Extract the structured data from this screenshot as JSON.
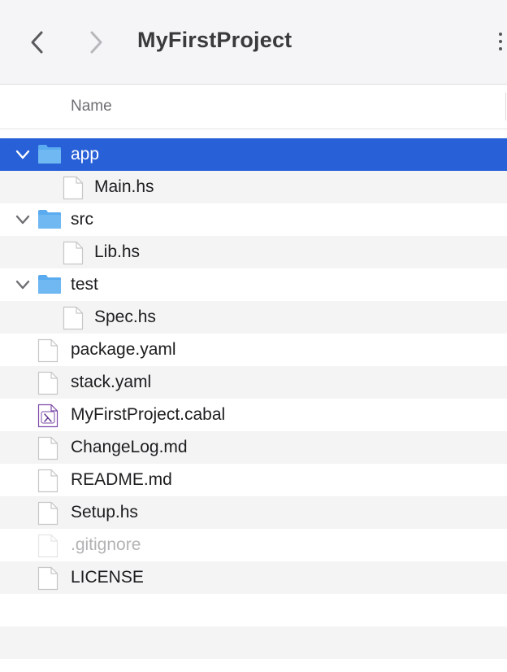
{
  "window": {
    "title": "MyFirstProject"
  },
  "toolbar": {
    "back_icon": "chevron-left-icon",
    "forward_icon": "chevron-right-icon",
    "more_icon": "more-vertical-icon"
  },
  "columns": {
    "name": "Name"
  },
  "colors": {
    "selection": "#2860d8",
    "folder": "#5aabef",
    "alternate_row": "#f4f4f5"
  },
  "files": [
    {
      "name": "app",
      "kind": "folder",
      "expanded": true,
      "selected": true
    },
    {
      "name": "Main.hs",
      "kind": "file",
      "parent": "app"
    },
    {
      "name": "src",
      "kind": "folder",
      "expanded": true
    },
    {
      "name": "Lib.hs",
      "kind": "file",
      "parent": "src"
    },
    {
      "name": "test",
      "kind": "folder",
      "expanded": true
    },
    {
      "name": "Spec.hs",
      "kind": "file",
      "parent": "test"
    },
    {
      "name": "package.yaml",
      "kind": "file"
    },
    {
      "name": "stack.yaml",
      "kind": "file"
    },
    {
      "name": "MyFirstProject.cabal",
      "kind": "cabal-file",
      "icon": "lambda-icon"
    },
    {
      "name": "ChangeLog.md",
      "kind": "file"
    },
    {
      "name": "README.md",
      "kind": "file"
    },
    {
      "name": "Setup.hs",
      "kind": "file"
    },
    {
      "name": ".gitignore",
      "kind": "file",
      "hidden": true
    },
    {
      "name": "LICENSE",
      "kind": "file"
    }
  ]
}
